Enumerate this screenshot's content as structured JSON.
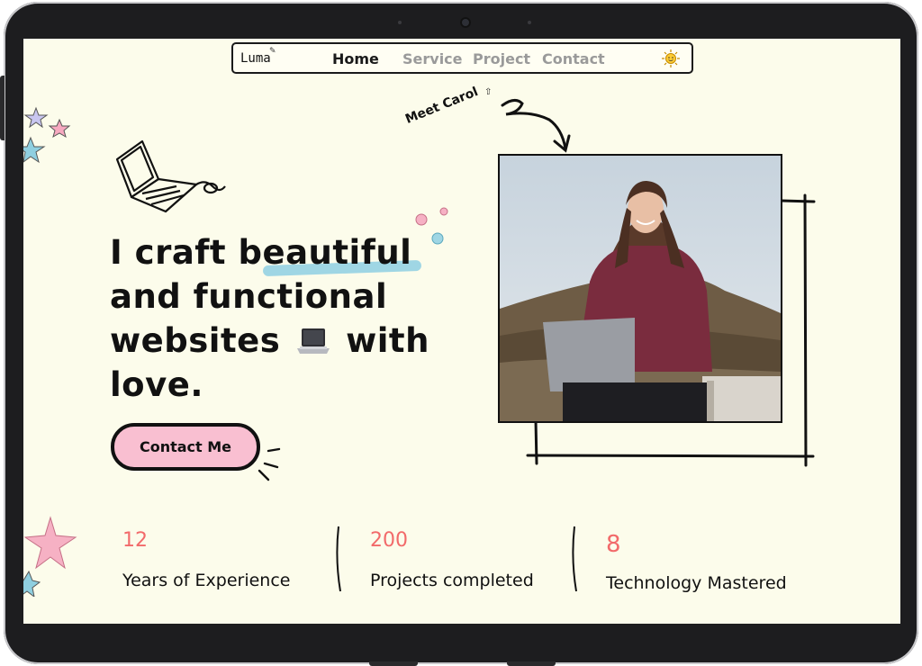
{
  "nav": {
    "logo": "Luma",
    "links": [
      "Home",
      "Service",
      "Project",
      "Contact"
    ],
    "active": "Home",
    "theme_icon": "sun-icon"
  },
  "hero": {
    "meet_label": "Meet Carol",
    "headline_part1": "I craft",
    "headline_highlight": "beautiful",
    "headline_line2": "and functional",
    "headline_line3a": "websites",
    "headline_line3b": "with",
    "headline_line4": "love.",
    "cta_label": "Contact Me"
  },
  "stats": [
    {
      "value": "12",
      "label": "Years of Experience"
    },
    {
      "value": "200",
      "label": "Projects completed"
    },
    {
      "value": "8",
      "label": "Technology Mastered"
    }
  ],
  "colors": {
    "background": "#fcfceb",
    "accent_pink": "#f9bfd1",
    "accent_blue": "#9fd6e4",
    "stat_red": "#f26a6a",
    "ink": "#111111"
  }
}
